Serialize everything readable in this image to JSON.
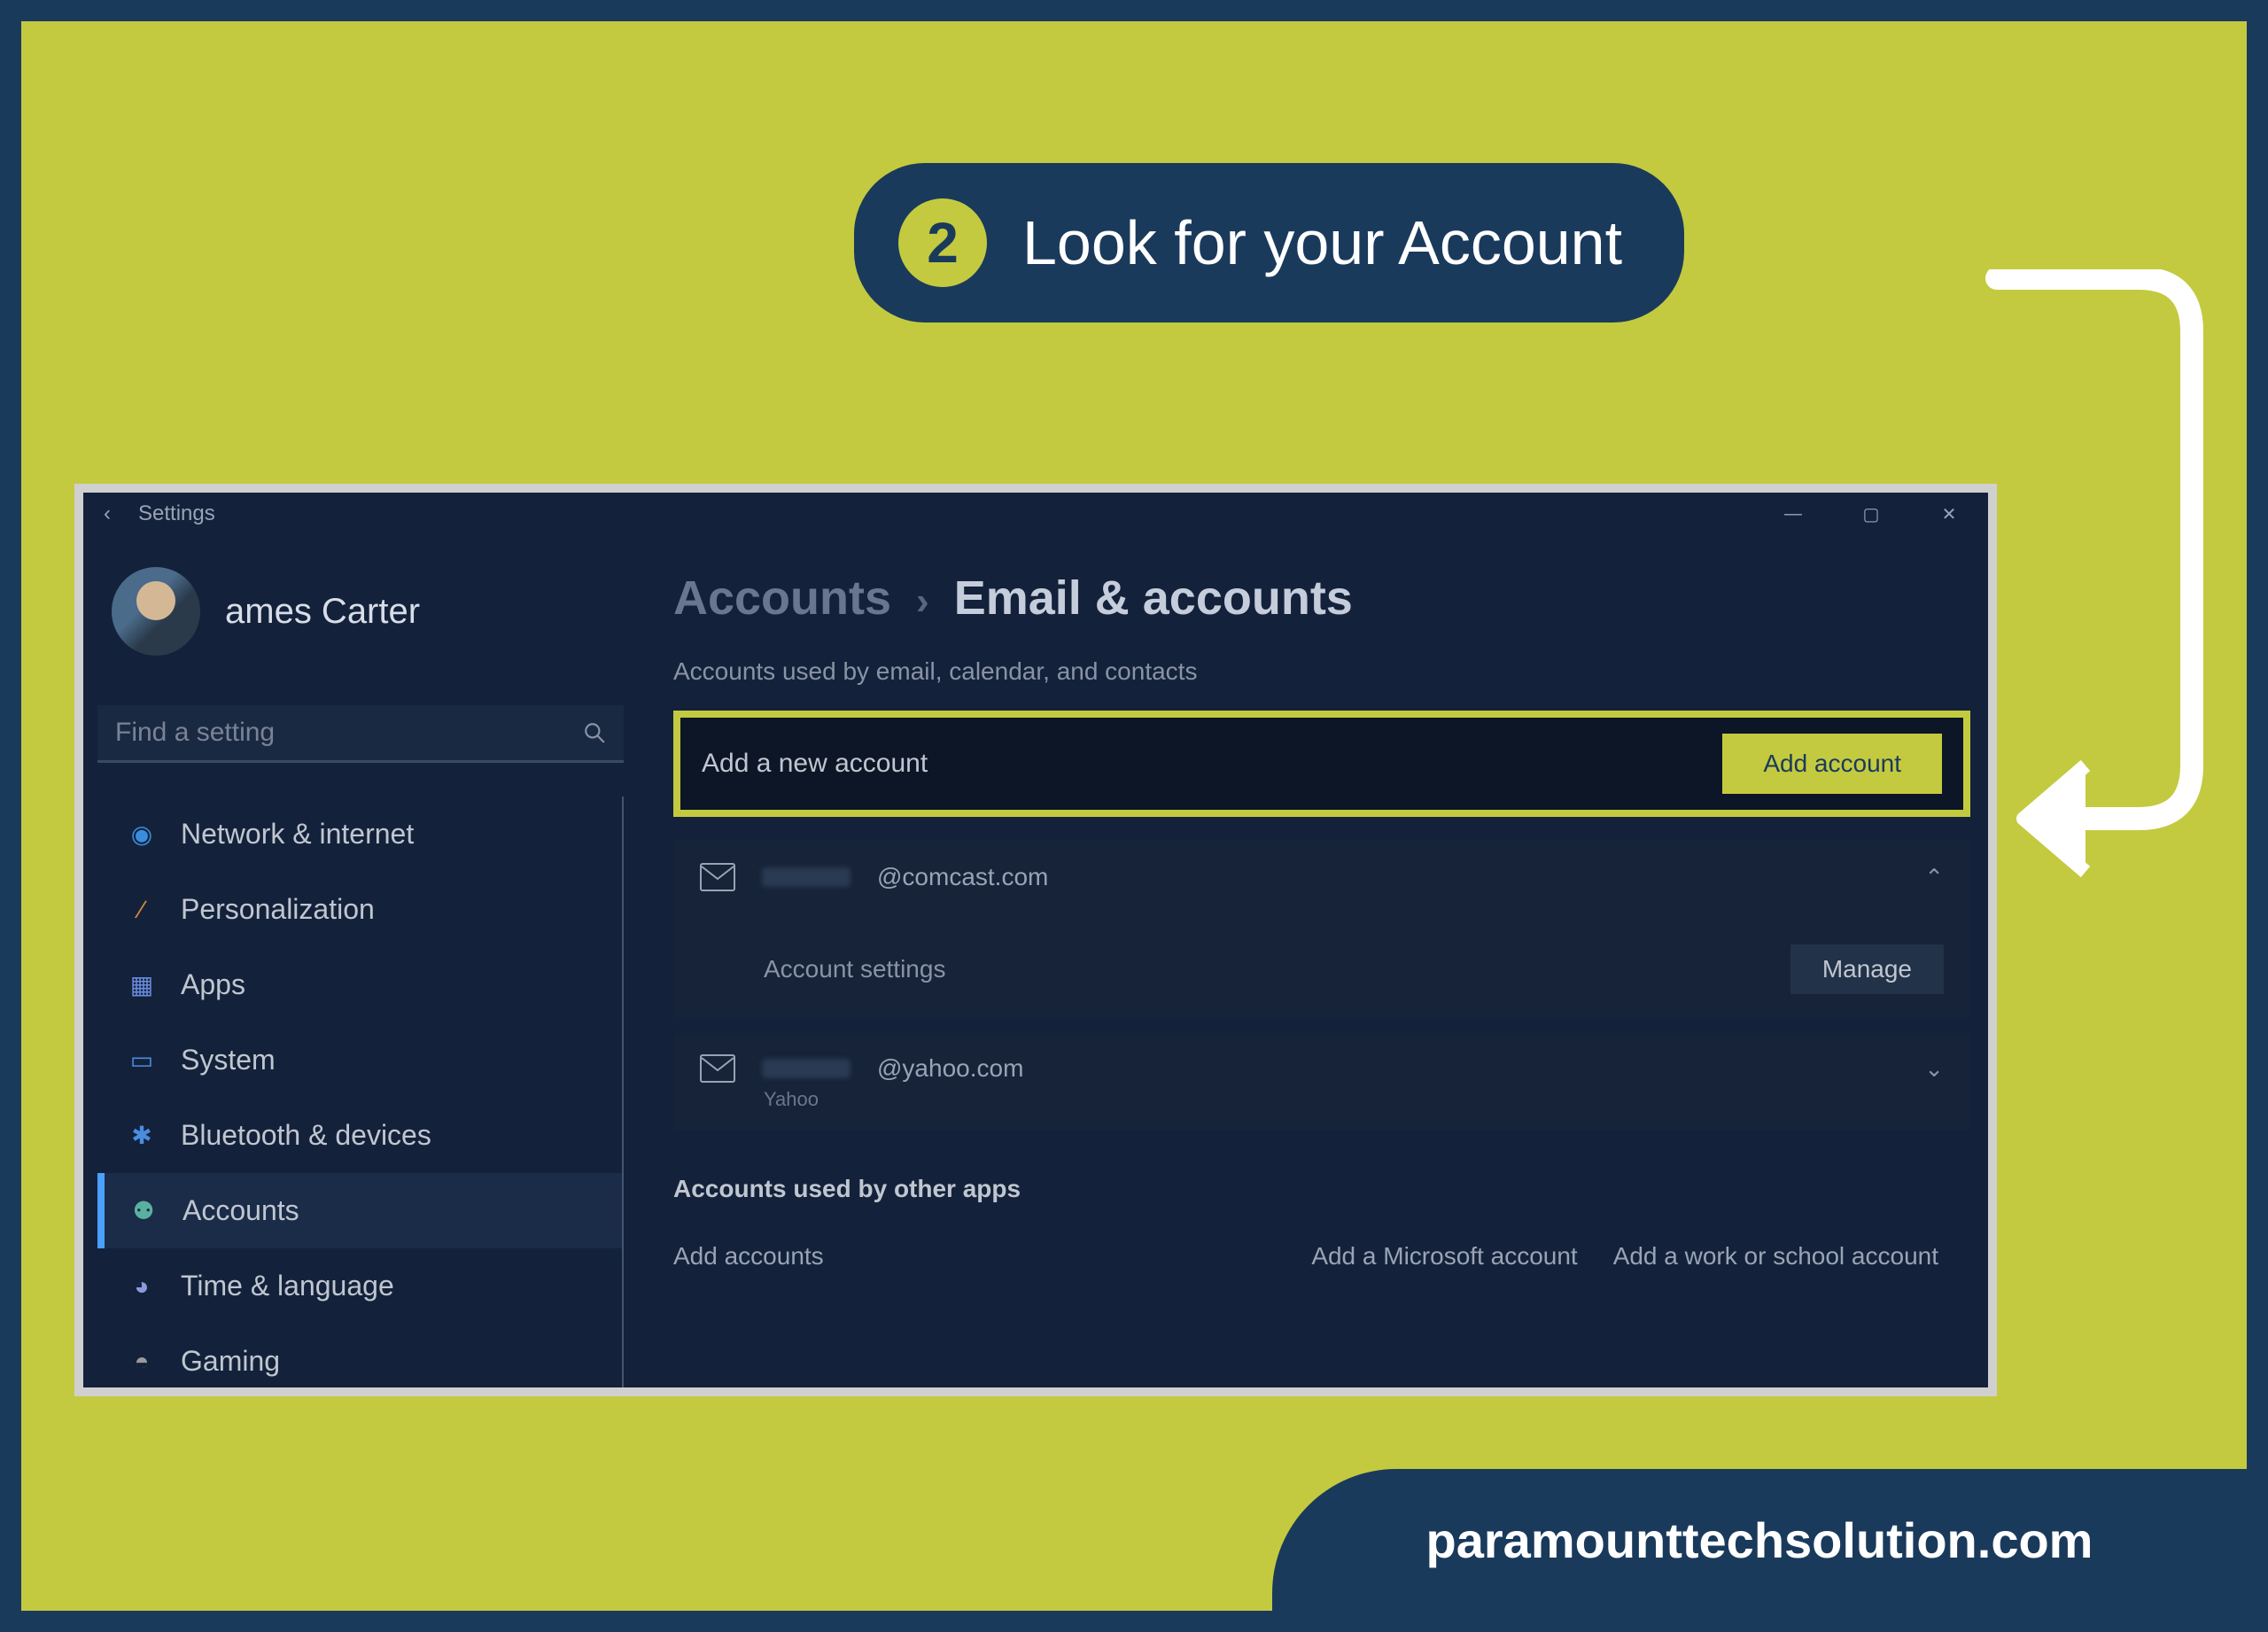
{
  "instruction": {
    "step_number": "2",
    "step_text": "Look for your Account"
  },
  "window": {
    "back_icon": "‹",
    "title": "Settings",
    "controls": {
      "min": "—",
      "max": "▢",
      "close": "✕"
    }
  },
  "profile": {
    "username": "ames Carter"
  },
  "search": {
    "placeholder": "Find a setting"
  },
  "sidebar": {
    "items": [
      {
        "label": "Network & internet",
        "icon": "wifi",
        "selected": false
      },
      {
        "label": "Personalization",
        "icon": "paint",
        "selected": false
      },
      {
        "label": "Apps",
        "icon": "apps",
        "selected": false
      },
      {
        "label": "System",
        "icon": "system",
        "selected": false
      },
      {
        "label": "Bluetooth & devices",
        "icon": "bluetooth",
        "selected": false
      },
      {
        "label": "Accounts",
        "icon": "accounts",
        "selected": true
      },
      {
        "label": "Time & language",
        "icon": "globe",
        "selected": false
      },
      {
        "label": "Gaming",
        "icon": "gaming",
        "selected": false
      }
    ]
  },
  "breadcrumb": {
    "parent": "Accounts",
    "sep": "›",
    "current": "Email & accounts"
  },
  "main": {
    "section1_label": "Accounts used by email, calendar, and contacts",
    "add_new_label": "Add a new account",
    "add_button": "Add account",
    "account1": {
      "email_suffix": "@comcast.com",
      "settings_label": "Account settings",
      "manage_button": "Manage",
      "expanded": true
    },
    "account2": {
      "email_suffix": "@yahoo.com",
      "provider": "Yahoo",
      "expanded": false
    },
    "section2_label": "Accounts used by other apps",
    "add_accounts_label": "Add accounts",
    "link_ms": "Add a Microsoft account",
    "link_work": "Add a work or school account"
  },
  "footer": {
    "text": "paramounttechsolution.com"
  },
  "colors": {
    "accent": "#c3ca3f",
    "frame": "#1a3a5c",
    "window_bg": "#13223a"
  }
}
